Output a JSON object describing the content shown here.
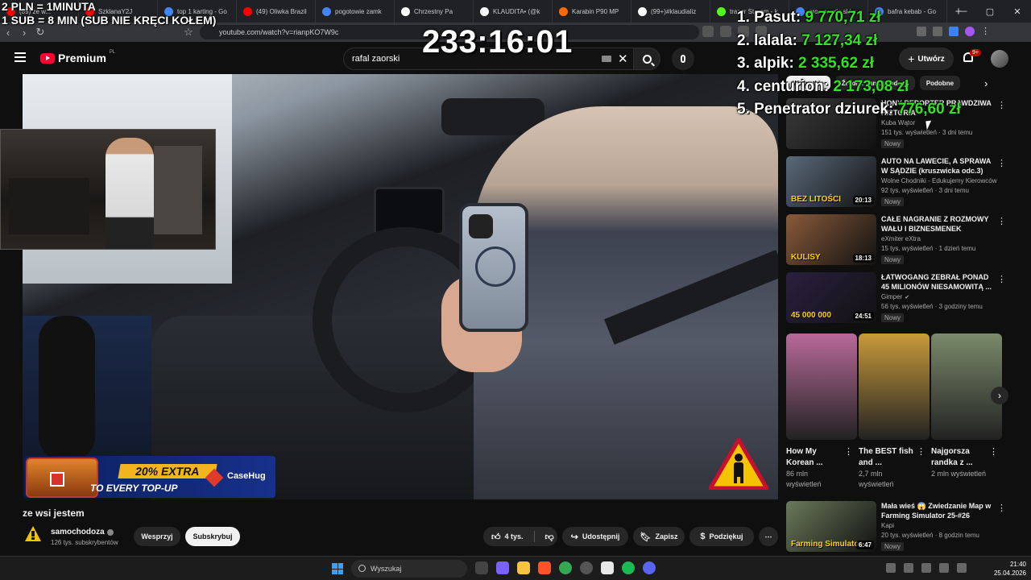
{
  "browser": {
    "tabs": [
      {
        "label": "(89) ze w...",
        "color": "#ff0000"
      },
      {
        "label": "SzklanaY2J",
        "color": "#ff0000"
      },
      {
        "label": "top 1 karting - Go",
        "color": "#4285f4"
      },
      {
        "label": "(49) Oliwka Brazil",
        "color": "#ff0000"
      },
      {
        "label": "pogotowie zamk",
        "color": "#4285f4"
      },
      {
        "label": "Chrzestny Pa",
        "color": "#ffffff"
      },
      {
        "label": "KLAUDITA• (@k",
        "color": "#ffffff"
      },
      {
        "label": "Karabin P90 MP",
        "color": "#ff6a00"
      },
      {
        "label": "(99+)#klaudializ",
        "color": "#ffffff"
      },
      {
        "label": "trazer Stream - k",
        "color": "#53fc18"
      },
      {
        "label": "promenada skło",
        "color": "#4285f4"
      },
      {
        "label": "bafra kebab - Go",
        "color": "#4285f4"
      }
    ],
    "url": "youtube.com/watch?v=rianpKO7W9c"
  },
  "youtube": {
    "logo_text": "Premium",
    "logo_country": "PL",
    "search_value": "rafal zaorski",
    "create_label": "Utwórz",
    "notif_badge": "9+"
  },
  "overlay": {
    "rate_line1": "2 PLN = 1MINUTA",
    "rate_line2": "1 SUB = 8 MIN (SUB NIE KRĘCI KOŁEM)",
    "timer": "233:16:01",
    "leaderboard": [
      {
        "rank": "1.",
        "name": "Pasut:",
        "amount": "9 770,71 zł"
      },
      {
        "rank": "2.",
        "name": "lalala:",
        "amount": "7 127,34 zł"
      },
      {
        "rank": "3.",
        "name": "alpik:",
        "amount": "2 335,62 zł"
      },
      {
        "rank": "4.",
        "name": "centurion:",
        "amount": "2 173,08 zł"
      },
      {
        "rank": "5.",
        "name": "Penetrator dziurek:",
        "amount": "776,60 zł"
      }
    ]
  },
  "ad": {
    "headline": "20% EXTRA",
    "subline": "TO EVERY TOP-UP",
    "brand": "CaseHug"
  },
  "video": {
    "title": "ze wsi jestem",
    "channel": "samochodoza",
    "subscribers": "126 tys. subskrybentów",
    "support_label": "Wesprzyj",
    "subscribe_label": "Subskrybuj",
    "likes": "4 tys.",
    "share_label": "Udostępnij",
    "save_label": "Zapisz",
    "thanks_label": "Podziękuj"
  },
  "sidebar": {
    "chips": [
      "Wszystkie",
      "Źródło: samochodoza",
      "Podobne"
    ],
    "recommendations": [
      {
        "title": "HONY REPORTER PRAWDZIWA HISTORIA",
        "channel": "Kuba Wątor",
        "verified": false,
        "meta": "151 tys. wyświetleń · 3 dni temu",
        "badge": "Nowy",
        "duration": "",
        "thumb": "#3a3a3a"
      },
      {
        "title": "AUTO NA LAWECIE, A SPRAWA W SĄDZIE (kruszwicka odc.3)",
        "channel": "Wolne Chodniki - Edukujemy Kierowców",
        "verified": false,
        "meta": "92 tys. wyświetleń · 3 dni temu",
        "badge": "Nowy",
        "duration": "20:13",
        "thumb": "#5a6a7a",
        "thumb_text": "BEZ LITOŚCI"
      },
      {
        "title": "CAŁE NAGRANIE Z ROZMOWY WAŁU I BIZNESMENEK",
        "channel": "eXmiter eXtra",
        "verified": false,
        "meta": "15 tys. wyświetleń · 1 dzień temu",
        "badge": "Nowy",
        "duration": "18:13",
        "thumb": "#8a5a3a",
        "thumb_text": "KULISY"
      },
      {
        "title": "ŁATWOGANG ZEBRAŁ PONAD 45 MILIONÓW NIESAMOWITĄ ...",
        "channel": "Gimper",
        "verified": true,
        "meta": "56 tys. wyświetleń · 3 godziny temu",
        "badge": "Nowy",
        "duration": "24:51",
        "thumb": "#2a2040",
        "thumb_text": "45 000 000"
      },
      {
        "title": "Mała wieś 😱 Zwiedzanie Map w Farming Simulator 25-#26",
        "channel": "Kapi",
        "verified": false,
        "meta": "20 tys. wyświetleń · 8 godzin temu",
        "badge": "Nowy",
        "duration": "6:47",
        "thumb": "#6a7a5a",
        "thumb_text": "Farming Simulator"
      }
    ],
    "shorts": [
      {
        "title": "How My Korean ...",
        "views": "86 mln wyświetleń",
        "thumb": "#b86a9a"
      },
      {
        "title": "The BEST fish and ...",
        "views": "2,7 mln wyświetleń",
        "thumb": "#c89a3a"
      },
      {
        "title": "Najgorsza randka z ...",
        "views": "2 mln wyświetleń",
        "thumb": "#7a8a6a"
      }
    ]
  },
  "taskbar": {
    "search_placeholder": "Wyszukaj",
    "time": "21:40",
    "date": "25.04.2026"
  }
}
